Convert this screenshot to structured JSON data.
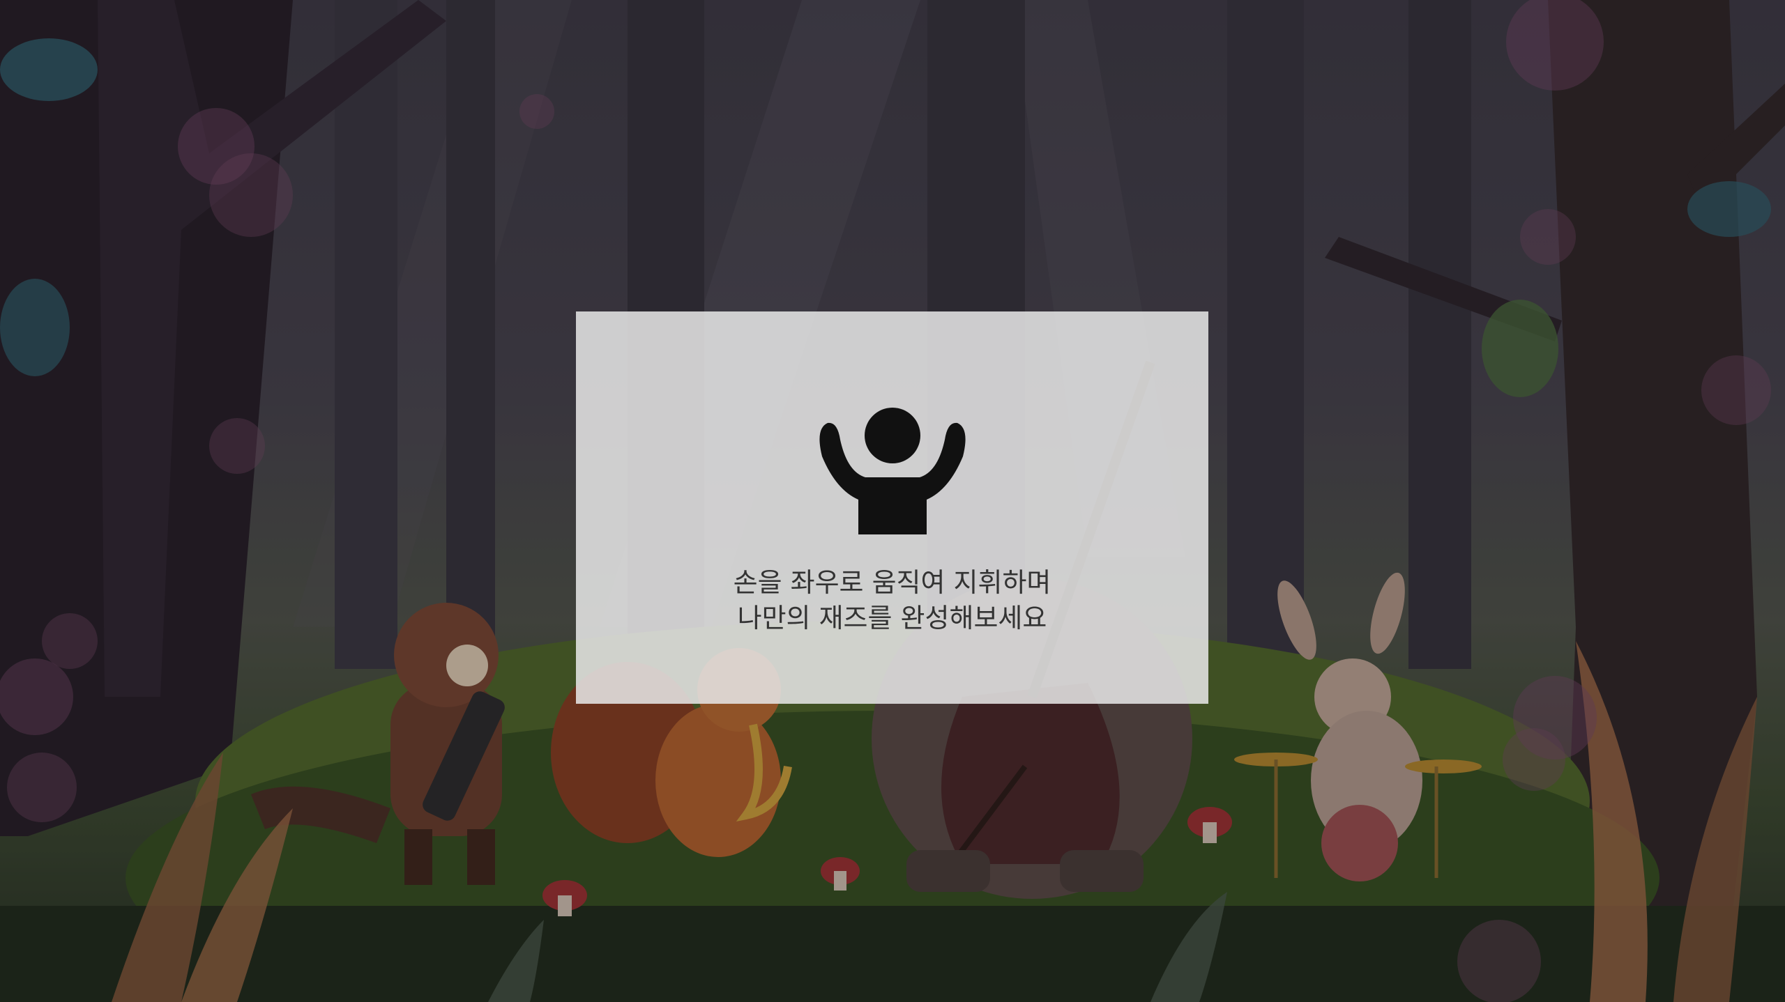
{
  "overlay": {
    "icon": "conductor-arms-raised-icon",
    "instruction_lines": [
      "손을 좌우로 움직여 지휘하며",
      "나만의 재즈를 완성해보세요"
    ]
  },
  "scene": {
    "description_icons": [
      "raccoon-melodica",
      "chipmunk-saxophone",
      "bear-double-bass",
      "rabbit-drums"
    ]
  },
  "colors": {
    "card": "#e8e8e8",
    "text": "#333333",
    "icon": "#111111",
    "forest_dark": "#2a2830"
  }
}
